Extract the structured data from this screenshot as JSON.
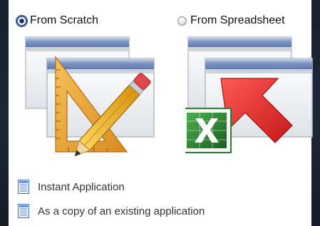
{
  "options": {
    "from_scratch": {
      "label": "From Scratch",
      "selected": true
    },
    "from_spreadsheet": {
      "label": "From Spreadsheet",
      "selected": false
    }
  },
  "links": [
    {
      "label": "Instant Application",
      "icon": "document-icon"
    },
    {
      "label": "As a copy of an existing application",
      "icon": "document-icon"
    }
  ],
  "colors": {
    "window_title_bar": "#7f96c2",
    "arrow_red": "#e03030",
    "excel_green": "#2e7d32",
    "pencil_yellow": "#f2b629",
    "ruler_orange": "#e8a23c"
  }
}
